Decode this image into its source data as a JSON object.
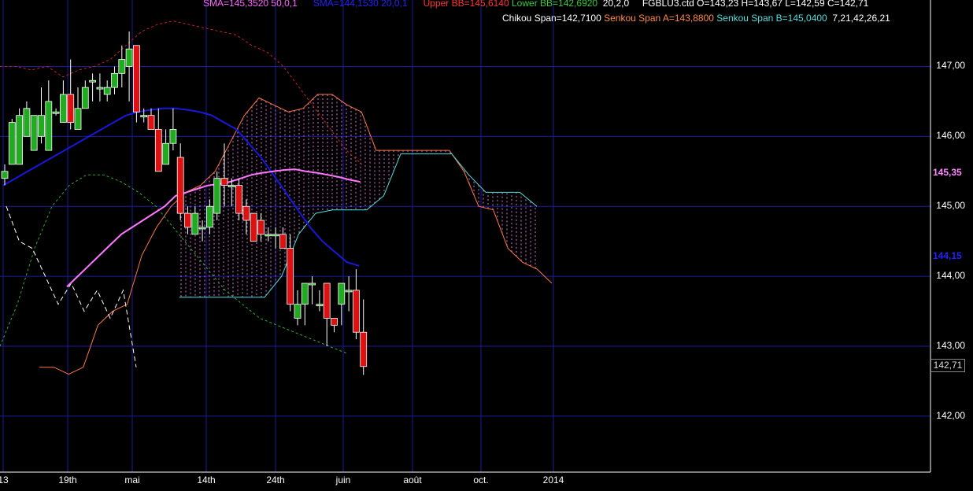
{
  "legend": {
    "line1": [
      {
        "text": "SMA=145,3520  50,0,1",
        "color": "#ff66ff"
      },
      {
        "text": "SMA=144,1530  20,0,1",
        "color": "#2222ff"
      },
      {
        "text": "Upper BB=145,6140",
        "color": "#ff3333"
      },
      {
        "text": "Lower BB=142,6920",
        "color": "#33cc33"
      },
      {
        "text": "20,2,0",
        "color": "#ffffff"
      },
      {
        "text": "FGBLU3.ctd O=143,23 H=143,67 L=142,59 C=142,71",
        "color": "#ffffff"
      }
    ],
    "line2": [
      {
        "text": "Chikou Span=142,7100",
        "color": "#ffffff"
      },
      {
        "text": "Senkou Span A=143,8800",
        "color": "#ff8844"
      },
      {
        "text": "Senkou Span B=145,0400",
        "color": "#55dddd"
      },
      {
        "text": "7,21,42,26,21",
        "color": "#ffffff"
      }
    ]
  },
  "price_tags": {
    "sma50": {
      "text": "145,35",
      "color": "#ff88ff",
      "value": 145.35
    },
    "sma20": {
      "text": "144,15",
      "color": "#2222ff",
      "value": 144.15
    },
    "last": {
      "text": "142,71",
      "value": 142.71
    }
  },
  "colors": {
    "up": "#22aa22",
    "down": "#dd1111",
    "grid": "#1c1c9c"
  },
  "chart_data": {
    "type": "candlestick",
    "y_ticks": [
      "147,00",
      "146,00",
      "145,00",
      "144,00",
      "143,00",
      "142,00"
    ],
    "y_tick_values": [
      147,
      146,
      145,
      144,
      143,
      142
    ],
    "ylim": [
      141.2,
      147.95
    ],
    "x_labels": [
      "13",
      "19th",
      "mai",
      "14th",
      "24th",
      "juin",
      "août",
      "oct.",
      "2014"
    ],
    "candles": [
      [
        145.4,
        145.5,
        145.3,
        145.6
      ],
      [
        145.6,
        146.2,
        146.0,
        146.25
      ],
      [
        145.6,
        146.3,
        146.1,
        146.4
      ],
      [
        146.0,
        146.4,
        146.2,
        146.5
      ],
      [
        145.8,
        146.3,
        145.9,
        146.3
      ],
      [
        146.0,
        146.3,
        145.9,
        146.7
      ],
      [
        145.8,
        146.5,
        145.8,
        146.8
      ],
      [
        146.35,
        146.35,
        146.3,
        146.4
      ],
      [
        146.2,
        146.6,
        146.2,
        146.8
      ],
      [
        146.6,
        146.2,
        146.1,
        147.1
      ],
      [
        146.1,
        146.4,
        146.1,
        146.7
      ],
      [
        146.4,
        146.7,
        146.4,
        146.8
      ],
      [
        146.8,
        146.8,
        146.5,
        146.9
      ],
      [
        146.7,
        146.7,
        146.5,
        146.9
      ],
      [
        146.6,
        146.7,
        146.5,
        146.8
      ],
      [
        146.7,
        146.9,
        146.6,
        147.0
      ],
      [
        146.9,
        147.1,
        146.7,
        147.3
      ],
      [
        147.0,
        147.25,
        146.5,
        147.5
      ],
      [
        147.3,
        146.35,
        146.2,
        147.3
      ],
      [
        146.3,
        146.3,
        146.2,
        146.4
      ],
      [
        146.3,
        146.1,
        146.1,
        146.4
      ],
      [
        146.1,
        145.5,
        145.5,
        146.4
      ],
      [
        145.6,
        145.9,
        145.6,
        146.1
      ],
      [
        145.9,
        146.1,
        145.8,
        146.4
      ],
      [
        145.7,
        144.9,
        144.8,
        145.9
      ],
      [
        144.9,
        144.7,
        144.6,
        145.0
      ],
      [
        144.6,
        144.9,
        144.6,
        145.0
      ],
      [
        144.7,
        144.7,
        144.5,
        144.8
      ],
      [
        144.7,
        145.0,
        144.6,
        145.1
      ],
      [
        144.9,
        145.4,
        144.8,
        145.5
      ],
      [
        145.4,
        145.3,
        145.0,
        145.9
      ],
      [
        145.3,
        145.3,
        145.0,
        145.4
      ],
      [
        145.3,
        144.9,
        144.8,
        145.4
      ],
      [
        145.0,
        144.8,
        144.6,
        145.1
      ],
      [
        144.9,
        144.5,
        144.5,
        144.9
      ],
      [
        144.8,
        144.6,
        144.5,
        144.9
      ],
      [
        144.6,
        144.6,
        144.5,
        144.7
      ],
      [
        144.6,
        144.6,
        144.4,
        144.7
      ],
      [
        144.6,
        144.4,
        144.4,
        144.7
      ],
      [
        144.4,
        143.6,
        143.5,
        144.6
      ],
      [
        143.4,
        143.6,
        143.3,
        143.8
      ],
      [
        143.6,
        143.9,
        143.3,
        143.9
      ],
      [
        143.9,
        143.9,
        143.6,
        144.0
      ],
      [
        143.6,
        143.6,
        143.5,
        143.8
      ],
      [
        143.9,
        143.4,
        143.0,
        143.9
      ],
      [
        143.4,
        143.3,
        143.2,
        143.4
      ],
      [
        143.6,
        143.9,
        143.3,
        143.9
      ],
      [
        143.8,
        143.8,
        143.5,
        144.0
      ],
      [
        143.8,
        143.2,
        143.1,
        144.1
      ],
      [
        143.2,
        142.71,
        142.59,
        143.67
      ]
    ],
    "sma50": [
      145.3,
      145.4,
      145.5,
      145.6,
      145.7,
      145.8,
      145.9,
      146.0,
      146.1,
      146.2,
      146.3,
      146.35,
      146.38,
      146.4,
      146.4,
      146.38,
      146.35,
      146.3,
      146.2,
      146.1,
      145.9,
      145.7,
      145.45,
      145.2,
      144.95,
      144.7,
      144.5,
      144.35,
      144.2,
      144.15
    ],
    "sma20": [
      143.85,
      144.0,
      144.15,
      144.3,
      144.45,
      144.6,
      144.7,
      144.8,
      144.9,
      145.0,
      145.15,
      145.2,
      145.25,
      145.3,
      145.32,
      145.35,
      145.4,
      145.45,
      145.48,
      145.5,
      145.52,
      145.53,
      145.5,
      145.48,
      145.45,
      145.42,
      145.38,
      145.35
    ],
    "upper_bb": [
      147.0,
      147.0,
      146.95,
      147.0,
      146.85,
      146.95,
      147.0,
      147.1,
      147.3,
      147.5,
      147.6,
      147.65,
      147.6,
      147.55,
      147.5,
      147.45,
      147.3,
      147.2,
      147.0,
      146.7,
      146.4,
      146.1,
      145.8,
      145.6
    ],
    "lower_bb": [
      143.0,
      143.6,
      144.4,
      145.0,
      145.3,
      145.45,
      145.45,
      145.35,
      145.2,
      145.0,
      144.7,
      144.4,
      144.1,
      143.8,
      143.6,
      143.4,
      143.3,
      143.2,
      143.1,
      143.0,
      142.9
    ],
    "chikou": [
      145.0,
      144.5,
      144.4,
      144.0,
      143.6,
      143.9,
      143.5,
      143.8,
      143.4,
      143.8,
      142.7
    ],
    "senkou_a": [
      142.7,
      142.7,
      142.6,
      142.7,
      143.3,
      143.5,
      143.6,
      144.3,
      144.7,
      145.0,
      145.2,
      145.3,
      145.5,
      145.9,
      146.3,
      146.55,
      146.45,
      146.35,
      146.4,
      146.6,
      146.6,
      146.45,
      146.35,
      145.8,
      145.8,
      145.8,
      145.8,
      145.8,
      145.8,
      145.5,
      145.0,
      144.95,
      144.4,
      144.2,
      144.1,
      143.9
    ],
    "senkou_b": [
      143.7,
      143.7,
      143.7,
      143.7,
      143.7,
      143.7,
      144.0,
      144.6,
      144.9,
      144.95,
      144.95,
      144.95,
      145.15,
      145.75,
      145.75,
      145.75,
      145.75,
      145.45,
      145.2,
      145.2,
      145.2,
      145.0
    ]
  }
}
